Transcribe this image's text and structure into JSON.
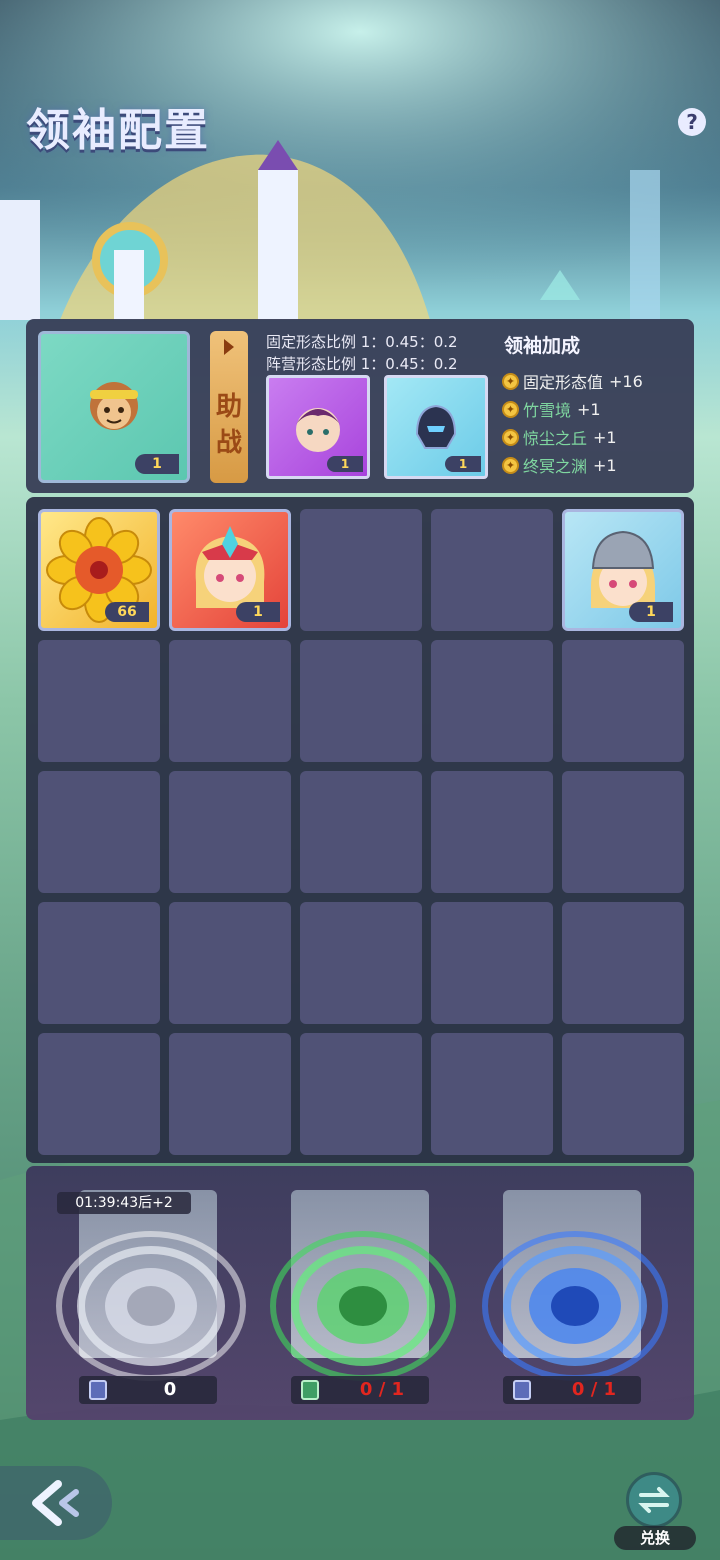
{
  "header": {
    "title": "领袖配置",
    "help_icon": "?"
  },
  "leader": {
    "count": "1"
  },
  "assist": {
    "label": "助战"
  },
  "ratios": {
    "fixed": "固定形态比例 1：0.45：0.2",
    "camp": "阵营形态比例 1：0.45：0.2"
  },
  "helpers": [
    {
      "count": "1"
    },
    {
      "count": "1"
    }
  ],
  "bonus": {
    "title": "领袖加成",
    "rows": [
      {
        "name": "固定形态值",
        "value": "+16",
        "color": "#f0f0f0"
      },
      {
        "name": "竹雪境",
        "value": "+1",
        "color": "#7fd7a0"
      },
      {
        "name": "惊尘之丘",
        "value": "+1",
        "color": "#7fd7a0"
      },
      {
        "name": "终冥之渊",
        "value": "+1",
        "color": "#7fd7a0"
      }
    ]
  },
  "grid": {
    "filled": [
      {
        "count": "66"
      },
      {
        "count": "1"
      },
      {
        "count": "1"
      }
    ]
  },
  "summon": {
    "timer": "01:39:43后+2",
    "counters": [
      {
        "value": "0"
      },
      {
        "value": "0 / 1"
      },
      {
        "value": "0 / 1"
      }
    ]
  },
  "nav": {
    "exchange_label": "兑换"
  }
}
